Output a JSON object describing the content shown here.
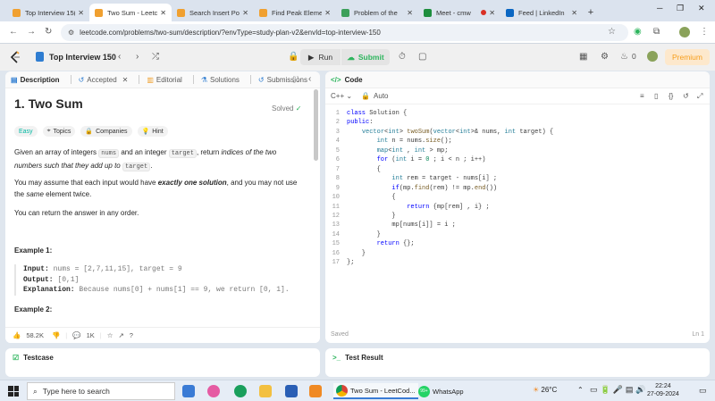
{
  "browser": {
    "tabs": [
      {
        "label": "Top Interview 15(",
        "color": "#f0a030",
        "active": false
      },
      {
        "label": "Two Sum - Leetc",
        "color": "#f0a030",
        "active": true
      },
      {
        "label": "Search Insert Po",
        "color": "#f0a030",
        "active": false
      },
      {
        "label": "Find Peak Eleme",
        "color": "#f0a030",
        "active": false
      },
      {
        "label": "Problem of the",
        "color": "#3ca05a",
        "active": false
      },
      {
        "label": "Meet - cmw",
        "color": "#1e8e3e",
        "active": false
      },
      {
        "label": "Feed | LinkedIn",
        "color": "#0a66c2",
        "active": false
      }
    ],
    "new_tab": "+",
    "url": "leetcode.com/problems/two-sum/description/?envType=study-plan-v2&envId=top-interview-150"
  },
  "header": {
    "list_title": "Top Interview 150",
    "run_label": "Run",
    "submit_label": "Submit",
    "streak_count": "0",
    "premium_label": "Premium"
  },
  "left_tabs": {
    "description": "Description",
    "accepted": "Accepted",
    "editorial": "Editorial",
    "solutions": "Solutions",
    "submissions": "Submissions"
  },
  "problem": {
    "title": "1. Two Sum",
    "status": "Solved",
    "difficulty": "Easy",
    "topics": "Topics",
    "companies": "Companies",
    "hint": "Hint",
    "p1_a": "Given an array of integers",
    "p1_code1": "nums",
    "p1_b": "and an integer",
    "p1_code2": "target",
    "p1_c": ", return",
    "p1_em": "indices of the two",
    "p1_em2": "numbers such that they add up to",
    "p1_code3": "target",
    "p1_d": ".",
    "p2_a": "You may assume that each input would have",
    "p2_b": "exactly one solution",
    "p2_c": ", and you may not use",
    "p2_d": "the",
    "p2_e": "same",
    "p2_f": "element twice.",
    "p3": "You can return the answer in any order.",
    "ex1_head": "Example 1:",
    "ex1_in_k": "Input:",
    "ex1_in_v": "nums = [2,7,11,15], target = 9",
    "ex1_out_k": "Output:",
    "ex1_out_v": "[0,1]",
    "ex1_exp_k": "Explanation:",
    "ex1_exp_v": "Because nums[0] + nums[1] == 9, we return [0, 1].",
    "ex2_head": "Example 2:"
  },
  "actions": {
    "likes": "58.2K",
    "comments": "1K"
  },
  "editor": {
    "panel_title": "Code",
    "language": "C++",
    "mode": "Auto",
    "saved": "Saved",
    "cursor": "Ln 1"
  },
  "code_lines": [
    "class Solution {",
    "public:",
    "    vector<int> twoSum(vector<int>& nums, int target) {",
    "        int n = nums.size();",
    "        map<int , int > mp;",
    "        for (int i = 0 ; i < n ; i++)",
    "        {",
    "            int rem = target - nums[i] ;",
    "            if(mp.find(rem) != mp.end())",
    "            {",
    "                return {mp[rem] , i} ;",
    "            }",
    "            mp[nums[i]] = i ;",
    "        }",
    "        return {};",
    "    }",
    "};"
  ],
  "bottom": {
    "testcase": "Testcase",
    "test_result": "Test Result"
  },
  "taskbar": {
    "search_placeholder": "Type here to search",
    "app1": "Two Sum - LeetCod...",
    "app2": "WhatsApp",
    "app2_badge": "99+",
    "temperature": "26°C",
    "time": "22:24",
    "date": "27-09-2024"
  }
}
